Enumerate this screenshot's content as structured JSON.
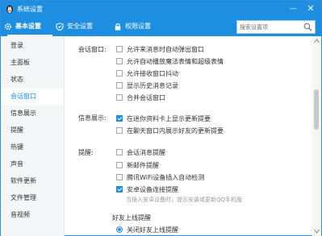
{
  "window": {
    "title": "系统设置",
    "minimize_glyph": "—",
    "close_glyph": "✕",
    "logo_icon": "qq-penguin-icon"
  },
  "tabs": [
    {
      "label": "基本设置",
      "icon": "gear-icon",
      "active": true
    },
    {
      "label": "安全设置",
      "icon": "shield-icon",
      "active": false
    },
    {
      "label": "权限设置",
      "icon": "lock-icon",
      "active": false
    }
  ],
  "search": {
    "placeholder": "搜索设置项",
    "icon": "search-icon"
  },
  "sidebar": {
    "items": [
      {
        "label": "登录"
      },
      {
        "label": "主面板"
      },
      {
        "label": "状态"
      },
      {
        "label": "会话窗口",
        "active": true
      },
      {
        "label": "信息展示"
      },
      {
        "label": "提醒"
      },
      {
        "label": "热键"
      },
      {
        "label": "声音"
      },
      {
        "label": "软件更新"
      },
      {
        "label": "文件管理"
      },
      {
        "label": "音视频"
      }
    ]
  },
  "content": {
    "session": {
      "label": "会话窗口:",
      "options": [
        {
          "text": "允许来消息时自动弹出窗口",
          "checked": false
        },
        {
          "text": "允许自动播放魔法表情和超级表情",
          "checked": false
        },
        {
          "text": "允许接收窗口抖动",
          "checked": false
        },
        {
          "text": "显示历史消息记录",
          "checked": false
        },
        {
          "text": "合并会话窗口",
          "checked": false
        }
      ]
    },
    "info": {
      "label": "信息展示:",
      "options": [
        {
          "text": "在迷你资料卡上显示更新提要",
          "checked": true
        },
        {
          "text": "在聊天窗口内展示好友的更新提要",
          "checked": false
        }
      ]
    },
    "remind": {
      "label": "提醒:",
      "options": [
        {
          "text": "会话消息提醒",
          "checked": false
        },
        {
          "text": "新邮件提醒",
          "checked": false
        },
        {
          "text": "腾讯WiFi设备插入自动检测",
          "checked": false
        },
        {
          "text": "安卓设备连接提醒",
          "checked": true
        }
      ],
      "hint": "当插入安卓设备时，提示安装或更新QQ手机版"
    },
    "friend_online": {
      "heading": "好友上线提醒",
      "radio": {
        "text": "关闭好友上线提醒",
        "selected": true
      }
    }
  },
  "colors": {
    "accent": "#1e8fe0",
    "sidebar_bg": "#f4f6f8"
  }
}
